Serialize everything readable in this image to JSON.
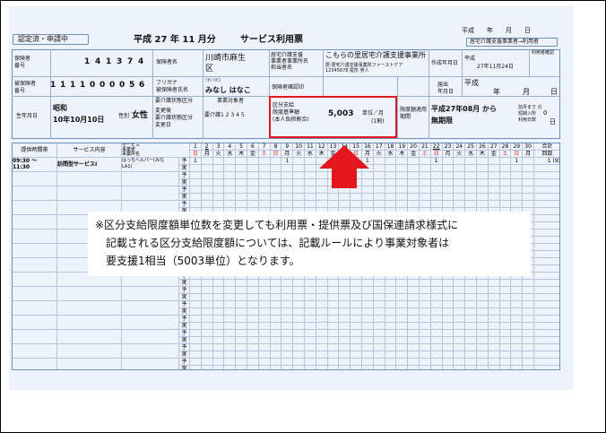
{
  "header": {
    "approval": "認定済・申請中",
    "period": "平成 27 年 11 月分",
    "form_title": "サービス利用票",
    "made_date": "平成　　年　　月　　日",
    "role_box": "居宅介護支援事業者→利用者"
  },
  "insurer": {
    "label": "保険者\n番号",
    "digits": [
      "1",
      "4",
      "1",
      "3",
      "7",
      "4"
    ],
    "name_label": "保険者名",
    "name": "川崎市麻生\n区"
  },
  "insured": {
    "label": "被保険者\n番号",
    "digits": [
      "1",
      "1",
      "1",
      "1",
      "0",
      "0",
      "0",
      "0",
      "5",
      "6"
    ],
    "kana_label": "フリガナ\n被保険者氏名",
    "kana": "ﾐﾅｼ ﾊﾅｺ",
    "name": "みなし はなこ"
  },
  "office": {
    "label": "居宅介護支援\n事業者事業所名\n担当者名",
    "name": "こもらの里居宅介護支援事業所",
    "sub": "居:居宅介護支援事業所ファーストケア",
    "sub2": "12345678  尾形 男人",
    "created_label": "作成年月日",
    "created_era": "平成",
    "created_date": "27年11月24日",
    "confirm_label": "保険者確認印",
    "stamp_label": "利用者確認",
    "filed_label": "届出\n年月日",
    "filed_era": "平成",
    "filed_y": "年",
    "filed_m": "月",
    "filed_d": "日"
  },
  "person": {
    "birth_label": "生年月日",
    "birth_era": "昭和",
    "birth_date": "10年10月10日",
    "sex_label": "性別",
    "sex": "女性",
    "care_level_label": "要介護状態区分",
    "care_level_label2": "変更後\n要介護状態区分\n変更日",
    "target_label": "事業対象者",
    "care_levels": "要介護1 2 3 4 5",
    "limit_label": "区分支給\n限度基準額\n(本人負担割合)",
    "limit_value": "5,003",
    "limit_unit": "単位／月",
    "limit_ratio": "(1割)",
    "period_label": "限度額適用\n期間",
    "period_value": "平成27年08月 から",
    "period_value2": "無期限",
    "prev_label": "前月まで の\n短期入所\n利用日数",
    "prev_value": "0",
    "prev_unit": "日"
  },
  "schedule": {
    "col_time": "提供時間帯",
    "col_service": "サービス内容",
    "col_office": "サービス\n事業者\n事業所名",
    "day_label": "日付",
    "dow_label": "曜日",
    "total_label": "合計",
    "count_label": "回数",
    "days": [
      "1",
      "2",
      "3",
      "4",
      "5",
      "6",
      "7",
      "8",
      "9",
      "10",
      "11",
      "12",
      "13",
      "14",
      "15",
      "16",
      "17",
      "18",
      "19",
      "20",
      "21",
      "22",
      "23",
      "24",
      "25",
      "26",
      "27",
      "28",
      "29",
      "30"
    ],
    "dows": [
      "日",
      "月",
      "火",
      "水",
      "木",
      "金",
      "土",
      "日",
      "月",
      "火",
      "水",
      "木",
      "金",
      "土",
      "日",
      "月",
      "火",
      "水",
      "木",
      "金",
      "土",
      "日",
      "月",
      "火",
      "水",
      "木",
      "金",
      "土",
      "日",
      "月"
    ],
    "circled": [
      2,
      22
    ],
    "red_dows": [
      0,
      6,
      7,
      13,
      14,
      20,
      21,
      27,
      28
    ],
    "plan_label": "予定",
    "actual_label": "実績",
    "row1": {
      "time": "09:30 ～\n  11:30",
      "service": "訪問型サービスⅠ",
      "office": "はっちヘルパー(みな\nLA1)",
      "marks": [
        "1",
        "",
        "",
        "",
        "",
        "",
        "",
        "",
        "1",
        "",
        "",
        "",
        "",
        "",
        "",
        "1",
        "",
        "",
        "",
        "",
        "",
        "1",
        "",
        "",
        "",
        "",
        "",
        "",
        "1",
        ""
      ],
      "total": "1 (9)"
    }
  },
  "note": {
    "line1": "※区分支給限度額単位数を変更しても利用票・提供票及び国保連請求様式に",
    "line2": "記載される区分支給限度額については、記載ルールにより事業対象者は",
    "line3": "要支援1相当（5003単位）となります。"
  },
  "colors": {
    "highlight": "#e3171e",
    "sheet": "#eef3fb",
    "line": "#6f8fb5"
  }
}
